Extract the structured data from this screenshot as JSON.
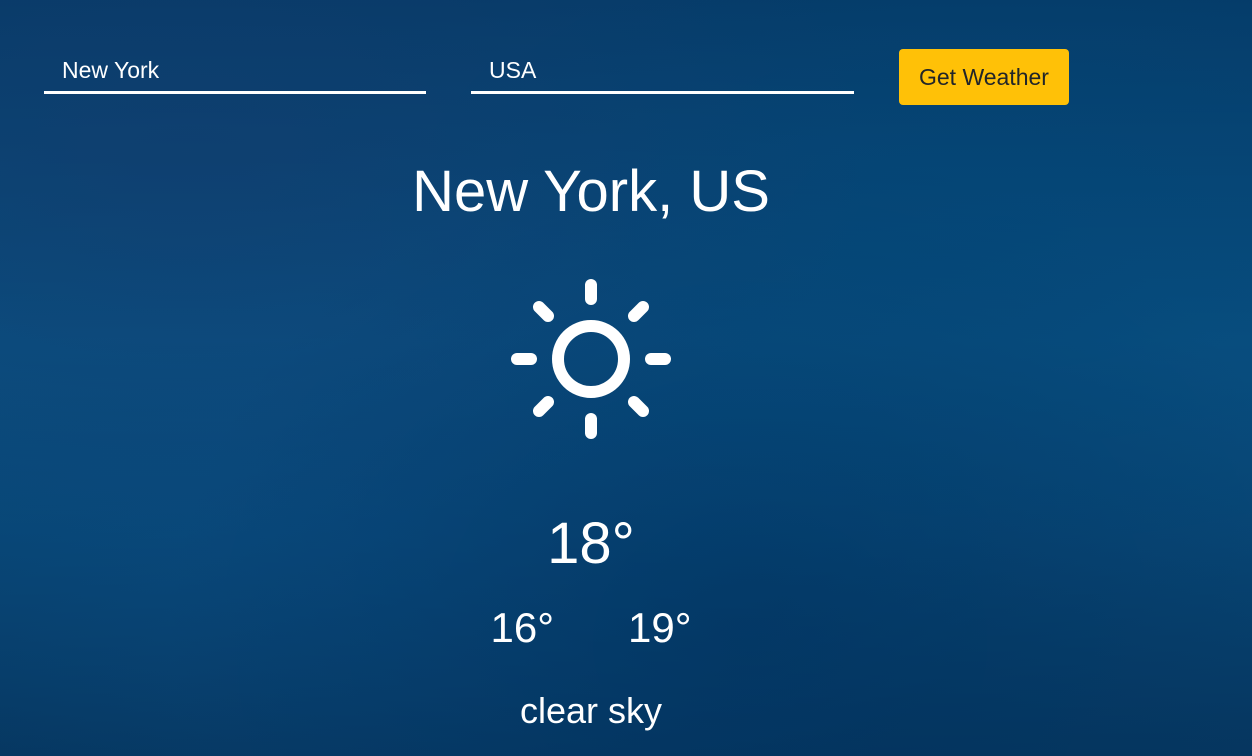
{
  "form": {
    "city_value": "New York",
    "country_value": "USA",
    "button_label": "Get Weather"
  },
  "weather": {
    "location": "New York, US",
    "icon": "sun-icon",
    "temperature": "18°",
    "temp_min": "16°",
    "temp_max": "19°",
    "description": "clear sky"
  },
  "colors": {
    "background": "#0a4a7a",
    "button": "#ffc107",
    "text": "#ffffff"
  }
}
